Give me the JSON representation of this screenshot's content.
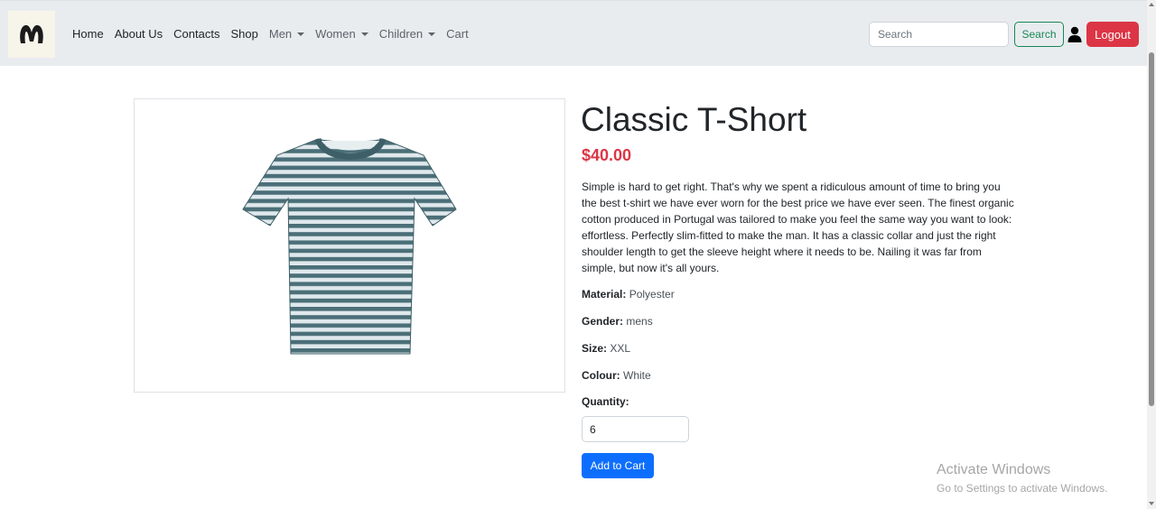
{
  "nav": {
    "items": [
      {
        "label": "Home",
        "dropdown": false,
        "muted": false
      },
      {
        "label": "About Us",
        "dropdown": false,
        "muted": false
      },
      {
        "label": "Contacts",
        "dropdown": false,
        "muted": false
      },
      {
        "label": "Shop",
        "dropdown": false,
        "muted": false
      },
      {
        "label": "Men",
        "dropdown": true,
        "muted": true
      },
      {
        "label": "Women",
        "dropdown": true,
        "muted": true
      },
      {
        "label": "Children",
        "dropdown": true,
        "muted": true
      },
      {
        "label": "Cart",
        "dropdown": false,
        "muted": true
      }
    ],
    "search_placeholder": "Search",
    "search_button": "Search",
    "logout_button": "Logout",
    "logo_icon": "m-brand-logo",
    "user_icon": "user-icon"
  },
  "product": {
    "title": "Classic T-Short",
    "price": "$40.00",
    "description": "Simple is hard to get right. That's why we spent a ridiculous amount of time to bring you the best t-shirt we have ever worn for the best price we have ever seen. The finest organic cotton produced in Portugal was tailored to make you feel the same way you want to look: effortless. Perfectly slim-fitted to make the man. It has a classic collar and just the right shoulder length to get the sleeve height where it needs to be. Nailing it was far from simple, but now it's all yours.",
    "attributes": [
      {
        "label": "Material:",
        "value": "Polyester"
      },
      {
        "label": "Gender:",
        "value": "mens"
      },
      {
        "label": "Size:",
        "value": "XXL"
      },
      {
        "label": "Colour:",
        "value": "White"
      }
    ],
    "quantity_label": "Quantity:",
    "quantity_value": "6",
    "add_to_cart": "Add to Cart",
    "image_icon": "striped-tshirt-image"
  },
  "watermark": {
    "title": "Activate Windows",
    "subtitle": "Go to Settings to activate Windows."
  },
  "colors": {
    "navbar_bg": "#e9ecef",
    "price": "#dc3545",
    "logout": "#dc3545",
    "search_outline": "#198754",
    "add_to_cart": "#0d6efd",
    "shirt_stripe": "#4b6f78"
  }
}
